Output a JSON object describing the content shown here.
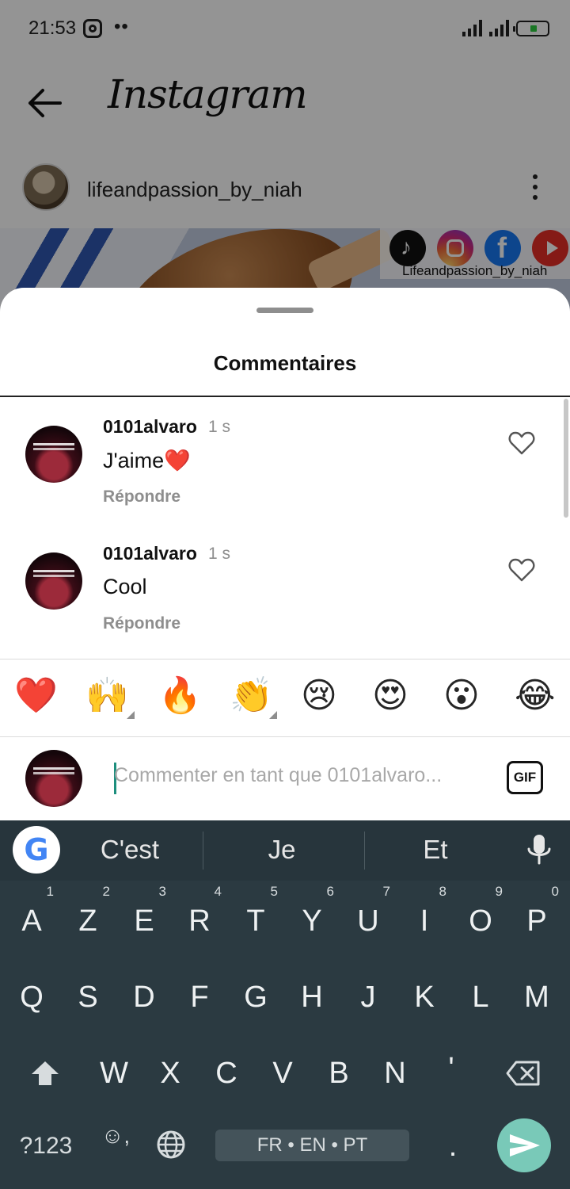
{
  "status_bar": {
    "time": "21:53",
    "dots": "••"
  },
  "app_bar": {
    "logo_text": "Instagram"
  },
  "post": {
    "username": "lifeandpassion_by_niah",
    "image_caption": "Lifeandpassion_by_niah"
  },
  "sheet": {
    "title": "Commentaires",
    "comments": [
      {
        "username": "0101alvaro",
        "time": "1 s",
        "text": "J'aime❤️",
        "reply": "Répondre"
      },
      {
        "username": "0101alvaro",
        "time": "1 s",
        "text": "Cool",
        "reply": "Répondre"
      }
    ],
    "emojis": [
      "❤️",
      "🙌",
      "🔥",
      "👏",
      "😢",
      "😍",
      "😮",
      "😂"
    ],
    "input": {
      "placeholder": "Commenter en tant que 0101alvaro...",
      "gif_label": "GIF"
    }
  },
  "keyboard": {
    "suggestions": [
      "C'est",
      "Je",
      "Et"
    ],
    "row1": [
      {
        "k": "A",
        "n": "1"
      },
      {
        "k": "Z",
        "n": "2"
      },
      {
        "k": "E",
        "n": "3"
      },
      {
        "k": "R",
        "n": "4"
      },
      {
        "k": "T",
        "n": "5"
      },
      {
        "k": "Y",
        "n": "6"
      },
      {
        "k": "U",
        "n": "7"
      },
      {
        "k": "I",
        "n": "8"
      },
      {
        "k": "O",
        "n": "9"
      },
      {
        "k": "P",
        "n": "0"
      }
    ],
    "row2": [
      "Q",
      "S",
      "D",
      "F",
      "G",
      "H",
      "J",
      "K",
      "L",
      "M"
    ],
    "row3": [
      "W",
      "X",
      "C",
      "V",
      "B",
      "N",
      "'"
    ],
    "symbols_label": "?123",
    "emoji_comma": "☺,",
    "space_label": "FR • EN • PT",
    "period": "."
  },
  "colors": {
    "send_button": "#79c9b8",
    "keyboard_bg": "#2b3a41",
    "cursor": "#1e8f7e"
  }
}
